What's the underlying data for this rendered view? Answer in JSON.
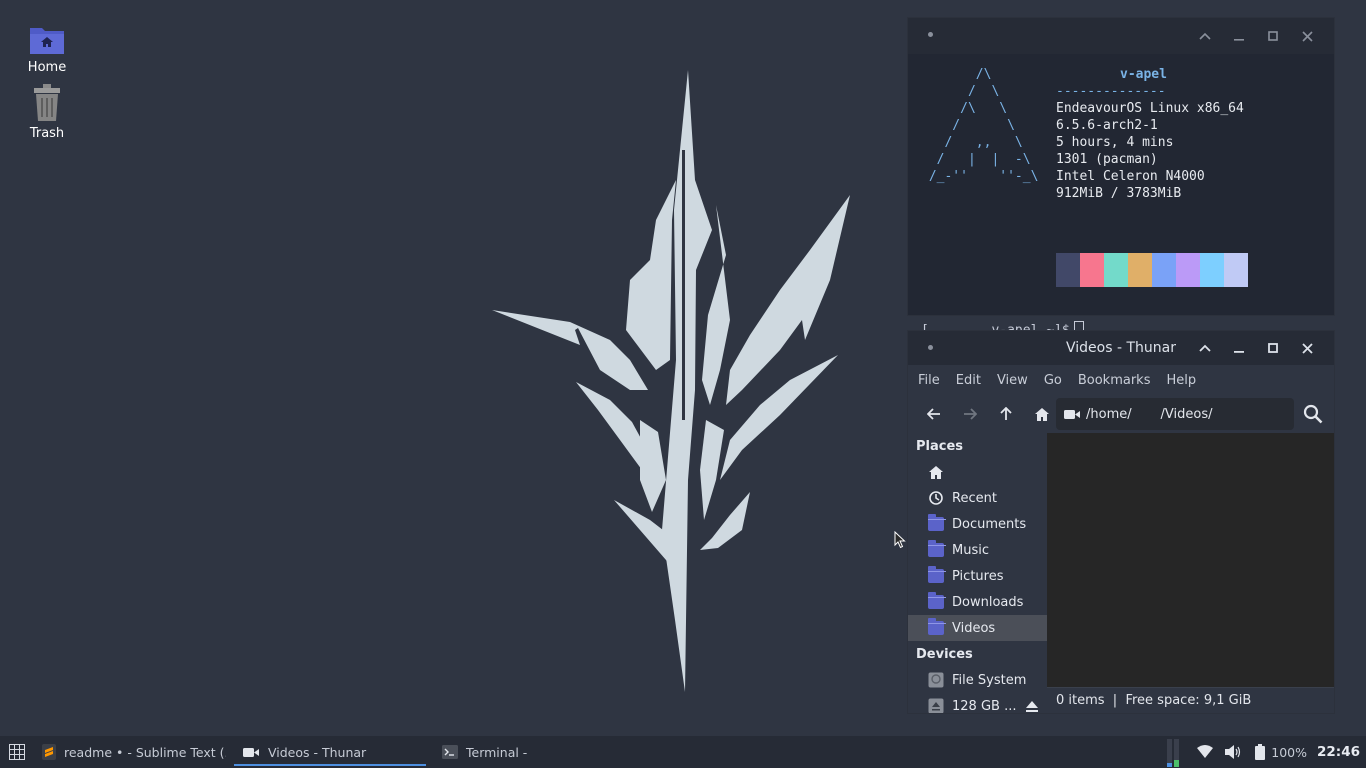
{
  "desktop": {
    "icons": [
      {
        "label": "Home",
        "icon": "home-folder-icon"
      },
      {
        "label": "Trash",
        "icon": "trash-icon"
      }
    ]
  },
  "terminal": {
    "title": "",
    "ascii_logo": "       /\\\n      /  \\\n     /\\   \\\n    /      \\\n   /   ,,   \\\n  /   |  |  -\\\n /_-''    ''-_\\",
    "user": "v-apel",
    "separator": "--------------",
    "info_lines": [
      "EndeavourOS Linux x86_64",
      "6.5.6-arch2-1",
      "5 hours, 4 mins",
      "1301 (pacman)",
      "Intel Celeron N4000",
      "912MiB / 3783MiB"
    ],
    "palette": [
      "#414868",
      "#f7768e",
      "#73daca",
      "#e0af68",
      "#7aa2f7",
      "#bb9af7",
      "#7dcfff",
      "#c0caf5"
    ],
    "prompt": "[        v-apel ~]$"
  },
  "thunar": {
    "title": "Videos - Thunar",
    "menu": [
      "File",
      "Edit",
      "View",
      "Go",
      "Bookmarks",
      "Help"
    ],
    "path": "/home/       /Videos/",
    "places_header": "Places",
    "places": [
      {
        "label": "",
        "icon": "home-icon"
      },
      {
        "label": "Recent",
        "icon": "clock-icon"
      },
      {
        "label": "Documents",
        "icon": "folder-documents-icon"
      },
      {
        "label": "Music",
        "icon": "folder-music-icon"
      },
      {
        "label": "Pictures",
        "icon": "folder-pictures-icon"
      },
      {
        "label": "Downloads",
        "icon": "folder-downloads-icon"
      },
      {
        "label": "Videos",
        "icon": "folder-videos-icon",
        "selected": true
      }
    ],
    "devices_header": "Devices",
    "devices": [
      {
        "label": "File System",
        "icon": "drive-icon"
      },
      {
        "label": "128 GB ...",
        "icon": "usb-drive-icon"
      }
    ],
    "status": "0 items  |  Free space: 9,1 GiB"
  },
  "taskbar": {
    "tasks": [
      {
        "label": "readme • - Sublime Text (...",
        "icon": "sublime-icon",
        "active": false
      },
      {
        "label": "Videos - Thunar",
        "icon": "video-camera-icon",
        "active": true
      },
      {
        "label": "Terminal -                              ...",
        "icon": "terminal-icon",
        "active": false
      }
    ],
    "battery": "100%",
    "clock": "22:46"
  }
}
